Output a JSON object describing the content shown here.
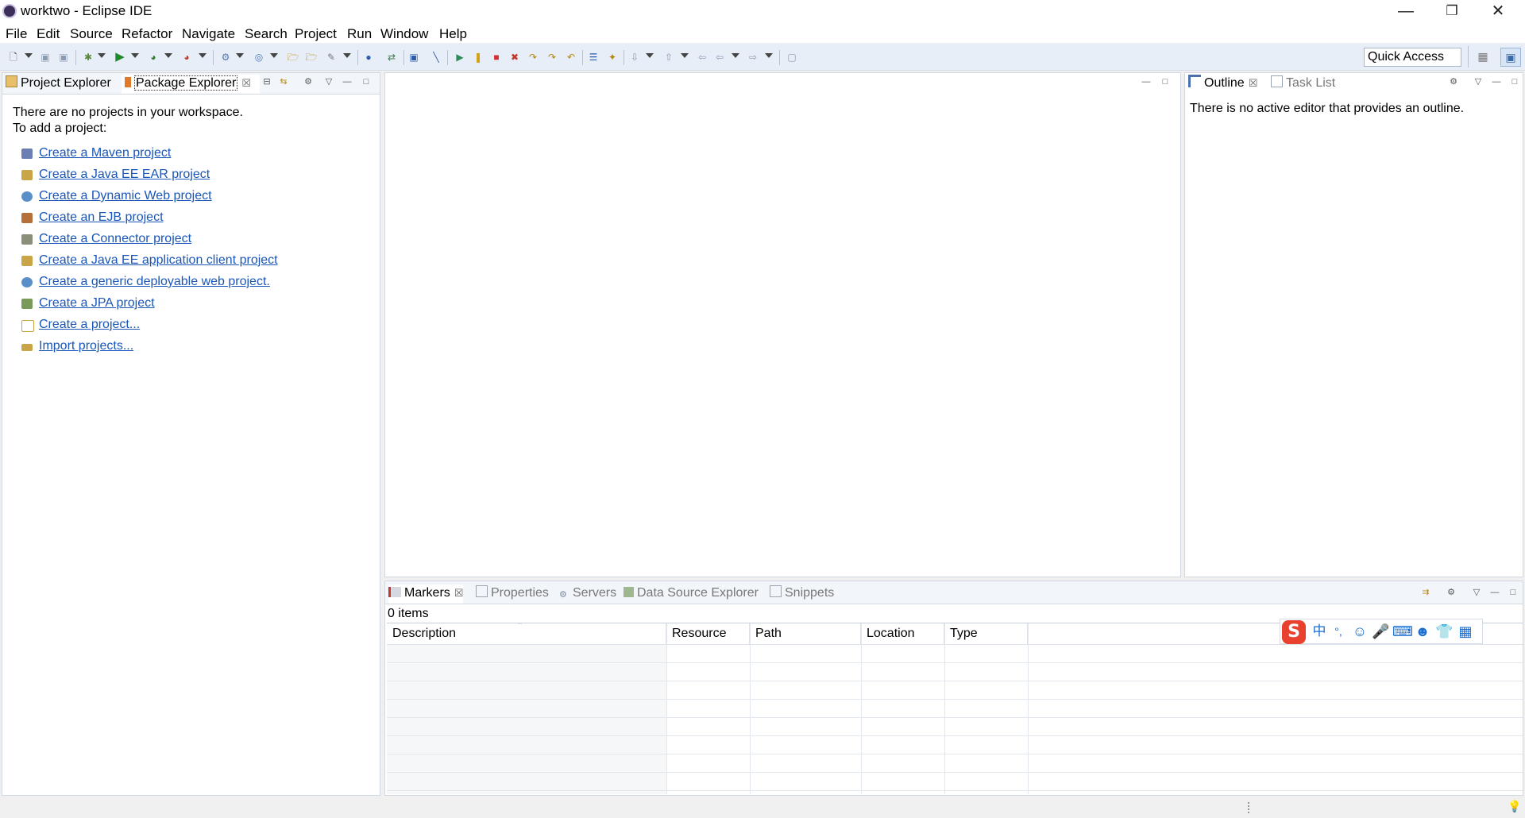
{
  "window": {
    "title": "worktwo - Eclipse IDE"
  },
  "window_controls": {
    "minimize": "—",
    "restore": "❐",
    "close": "✕"
  },
  "menu": [
    "File",
    "Edit",
    "Source",
    "Refactor",
    "Navigate",
    "Search",
    "Project",
    "Run",
    "Window",
    "Help"
  ],
  "toolbar": {
    "quick_access": "Quick Access"
  },
  "left_panel": {
    "tabs": [
      "Project Explorer",
      "Package Explorer"
    ],
    "empty_line1": "There are no projects in your workspace.",
    "empty_line2": "To add a project:",
    "links": [
      "Create a Maven project",
      "Create a Java EE EAR project",
      "Create a Dynamic Web project",
      "Create an EJB project",
      "Create a Connector project",
      "Create a Java EE application client project",
      "Create a generic deployable web project.",
      "Create a JPA project",
      "Create a project...",
      "Import projects..."
    ]
  },
  "right_panel": {
    "tabs": [
      "Outline",
      "Task List"
    ],
    "message": "There is no active editor that provides an outline."
  },
  "bottom_panel": {
    "tabs": [
      "Markers",
      "Properties",
      "Servers",
      "Data Source Explorer",
      "Snippets"
    ],
    "count": "0 items",
    "columns": [
      "Description",
      "Resource",
      "Path",
      "Location",
      "Type"
    ]
  },
  "ime_bar": {
    "lang": "中",
    "punct": "°,"
  },
  "colors": {
    "link": "#1a56b8",
    "toolbar_bg": "#e8eef7",
    "panel_border": "#d2d8e0",
    "ime_logo": "#e8422f"
  }
}
